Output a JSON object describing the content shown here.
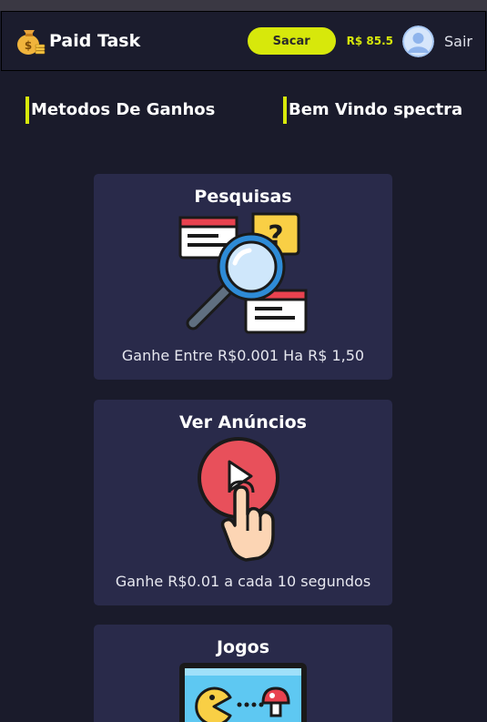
{
  "nav": {
    "brand_name": "Paid Task",
    "withdraw_label": "Sacar",
    "balance": "R$ 85.5",
    "logout_label": "Sair"
  },
  "sections": {
    "left_title": "Metodos De Ganhos",
    "right_title": "Bem Vindo spectra"
  },
  "cards": [
    {
      "title": "Pesquisas",
      "description": "Ganhe Entre R$0.001 Ha R$ 1,50",
      "icon": "survey-magnifier-icon"
    },
    {
      "title": "Ver Anúncios",
      "description": "Ganhe R$0.01 a cada 10 segundos",
      "icon": "play-click-icon"
    },
    {
      "title": "Jogos",
      "description": "",
      "icon": "pacman-game-icon"
    }
  ],
  "colors": {
    "background": "#1a1b2b",
    "navbar": "#1b1c2d",
    "card": "#292a4a",
    "accent": "#d7e80b"
  }
}
